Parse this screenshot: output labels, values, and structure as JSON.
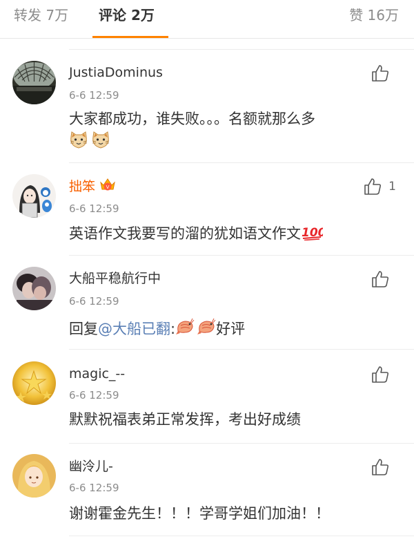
{
  "tabs": {
    "repost": "转发 7万",
    "comments": "评论 2万",
    "likes": "赞 16万"
  },
  "colors": {
    "accent": "#ff8200",
    "vip_name": "#f86000",
    "mention": "#5a7fb5",
    "muted": "#8c8c8c"
  },
  "comments": [
    {
      "username": "JustiaDominus",
      "time": "6-6 12:59",
      "text": "大家都成功，谁失败。。。名额就那么多",
      "emoji": [
        "cat-emoji",
        "cat-emoji"
      ],
      "like_count": ""
    },
    {
      "username": "拙笨",
      "badge": "vip-crown-badge",
      "time": "6-6 12:59",
      "text": "英语作文我要写的溜的犹如语文作文",
      "emoji": [
        "hundred-points-emoji"
      ],
      "like_count": "1"
    },
    {
      "username": "大船平稳航行中",
      "time": "6-6 12:59",
      "text_prefix": "回复",
      "mention": "@大船已翻",
      "text_colon": ":",
      "emoji": [
        "shrimp-emoji",
        "shrimp-emoji"
      ],
      "text_suffix": "好评",
      "like_count": ""
    },
    {
      "username": "magic_--",
      "time": "6-6 12:59",
      "text": "默默祝福表弟正常发挥，考出好成绩",
      "like_count": ""
    },
    {
      "username": "幽泠儿-",
      "time": "6-6 12:59",
      "text": "谢谢霍金先生！！！学哥学姐们加油！！",
      "like_count": ""
    }
  ]
}
